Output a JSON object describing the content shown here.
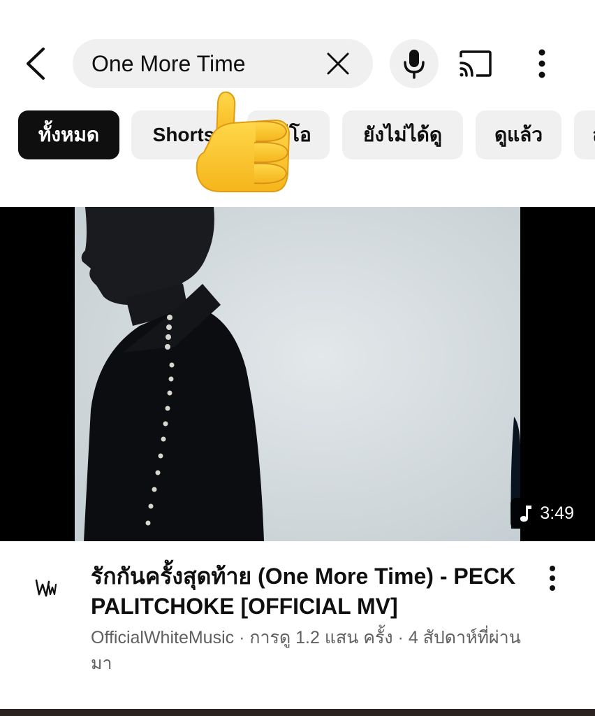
{
  "header": {
    "search_value": "One More Time",
    "icons": [
      "back-arrow-icon",
      "clear-icon",
      "microphone-icon",
      "cast-icon",
      "more-vertical-icon"
    ]
  },
  "chips": [
    {
      "label": "ทั้งหมด",
      "active": true
    },
    {
      "label": "Shorts",
      "active": false
    },
    {
      "label": "วิดีโอ",
      "active": false
    },
    {
      "label": "ยังไม่ได้ดู",
      "active": false
    },
    {
      "label": "ดูแล้ว",
      "active": false
    },
    {
      "label": "ล",
      "active": false
    }
  ],
  "video": {
    "duration": "3:49",
    "title": "รักกันครั้งสุดท้าย (One More Time) - PECK PALITCHOKE [OFFICIAL MV]",
    "channel": "OfficialWhiteMusic",
    "separator": " · ",
    "views": "การดู 1.2 แสน ครั้ง",
    "age": "4 สัปดาห์ที่ผ่านมา",
    "channel_logo_text": "WM"
  },
  "colors": {
    "chip_bg": "#f0f0f0",
    "chip_active_bg": "#0f0f0f",
    "secondary_text": "#606060"
  }
}
